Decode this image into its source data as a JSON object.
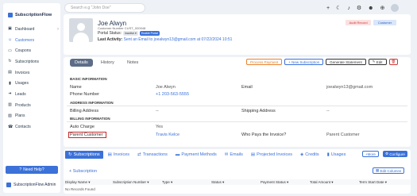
{
  "app": {
    "name": "SubscriptionFlow"
  },
  "sidebar": {
    "items": [
      {
        "icon": "dashboard-icon",
        "label": "Dashboard",
        "active": false
      },
      {
        "icon": "customers-icon",
        "label": "Customers",
        "active": true
      },
      {
        "icon": "coupons-icon",
        "label": "Coupons",
        "active": false
      },
      {
        "icon": "subscriptions-icon",
        "label": "Subscriptions",
        "active": false
      },
      {
        "icon": "invoices-icon",
        "label": "Invoices",
        "active": false
      },
      {
        "icon": "usages-icon",
        "label": "Usages",
        "active": false
      },
      {
        "icon": "leads-icon",
        "label": "Leads",
        "active": false
      },
      {
        "icon": "products-icon",
        "label": "Products",
        "active": false
      },
      {
        "icon": "plans-icon",
        "label": "Plans",
        "active": false
      },
      {
        "icon": "contacts-icon",
        "label": "Contacts",
        "active": false
      }
    ],
    "help_label": "Need Help?",
    "user_label": "SubscriptionFlow Admin"
  },
  "topbar": {
    "search_placeholder": "Search e.g \"John Doe\""
  },
  "customer": {
    "name": "Joe Alwyn",
    "number": "Customer Number CUST_000048",
    "portal_status_label": "Portal Status:",
    "portal_status_value": "Inactive ▾",
    "enable_portal_label": "Enable Portal",
    "last_activity_label": "Last Activity:",
    "last_activity_value": "Sent an Email to joealwyn13@gmail.com at 07/22/2024 10:51",
    "audit_label": "Audit Record",
    "type_badge": "Customer"
  },
  "detail_tabs": [
    {
      "label": "Details",
      "active": true
    },
    {
      "label": "History",
      "active": false
    },
    {
      "label": "Notes",
      "active": false
    }
  ],
  "actions": {
    "process_payment": "Process Payment",
    "new_subscription": "+ New Subscription",
    "generate_statement": "Generate Statement",
    "edit": "Edit",
    "delete_icon": "trash-icon"
  },
  "basic_info": {
    "section_title": "BASIC INFORMATION",
    "name_label": "Name",
    "name_value": "Joe Alwyn",
    "phone_label": "Phone Number",
    "phone_value": "+1 203-563-5555",
    "email_label": "Email",
    "email_value": "joealwyn13@gmail.com"
  },
  "address_info": {
    "section_title": "ADDRESS INFORMATION",
    "billing_label": "Billing Address",
    "billing_value": "--",
    "shipping_label": "Shipping Address",
    "shipping_value": "--"
  },
  "billing_info": {
    "section_title": "BILLING INFORMATION",
    "auto_charge_label": "Auto Charge",
    "auto_charge_value": "Yes",
    "parent_customer_label": "Parent Customer",
    "parent_customer_value": "Travis Kelce",
    "who_pays_label": "Who Pays the Invoice?",
    "who_pays_value": "Parent Customer"
  },
  "sub_tabs": [
    {
      "icon": "subscriptions-icon",
      "label": "Subscriptions",
      "active": true
    },
    {
      "icon": "invoices-icon",
      "label": "Invoices",
      "active": false
    },
    {
      "icon": "transactions-icon",
      "label": "Transactions",
      "active": false
    },
    {
      "icon": "payment-methods-icon",
      "label": "Payment Methods",
      "active": false
    },
    {
      "icon": "emails-icon",
      "label": "Emails",
      "active": false
    },
    {
      "icon": "projected-invoices-icon",
      "label": "Projected Invoices",
      "active": false
    },
    {
      "icon": "credits-icon",
      "label": "Credits",
      "active": false
    },
    {
      "icon": "usages-icon",
      "label": "Usages",
      "active": false
    }
  ],
  "subs_panel": {
    "more_label": "+More",
    "configure_label": "Configure",
    "add_subscription_label": "+ Subscription",
    "edit_columns_label": "Edit Columns",
    "columns": [
      "Display Name ▾",
      "Subscription Number ▾",
      "Type ▾",
      "Status ▾",
      "Payment Status ▾",
      "Total Amount ▾",
      "Term Start Date ▾"
    ],
    "empty_text": "No Records Found"
  }
}
